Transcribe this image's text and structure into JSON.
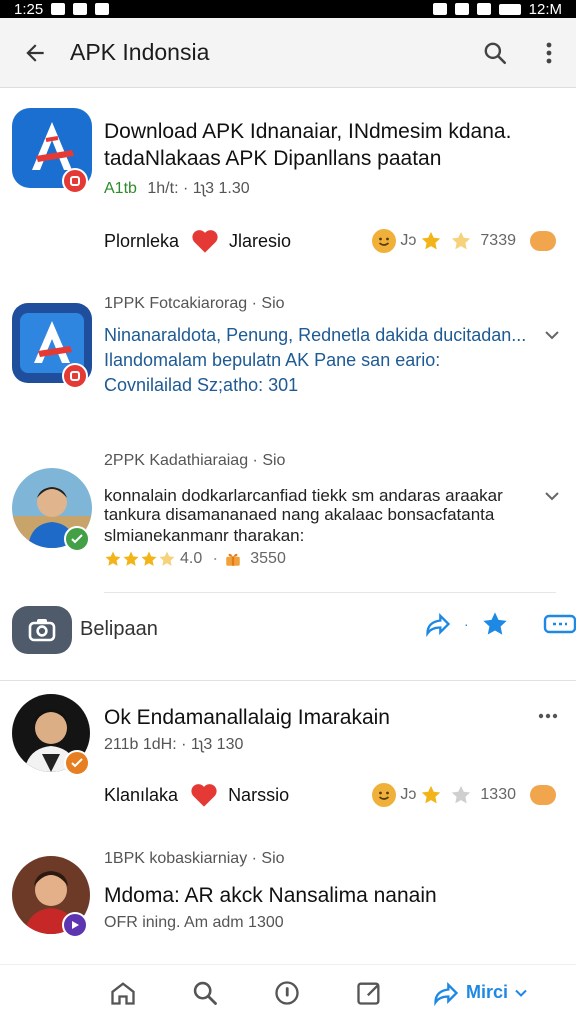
{
  "status_bar": {
    "time": "1:25",
    "right_text": "12:M"
  },
  "appbar": {
    "title": "APK Indonsia"
  },
  "item1": {
    "title_line1": "Download APK Idnanaiar, INdmesim kdana.",
    "title_line2": "tadaNlakaas APK Dipanllans paatan",
    "meta_a": "A1tb",
    "meta_b": "1h/t: · 1ʅ3 1.30",
    "reaction_name": "Plornleka",
    "reaction_label": "Jlaresio",
    "rating_text": "Jɔ",
    "rating_count": "7339"
  },
  "item2": {
    "header": "1PPK Fotcakiarorag · Sio",
    "line1": "Ninanaraldota, Penung, Rednetla dakida ducitadan...",
    "line2": "Ilandomalam bepulatn AK Pane san eario:",
    "line3": "Covnilailad Sz;atho: 301"
  },
  "item3": {
    "header": "2PPK Kadathiaraiag · Sio",
    "line1": "konnalain dodkarlarcanfiad tiekk sm andaras araakar",
    "line2": "tankura disamananaed nang akalaac bonsacfatanta",
    "line3": "slmianekanmanr tharakan:",
    "rating": "4.0",
    "count": "3550"
  },
  "section": {
    "label": "Belipaan"
  },
  "item4": {
    "title": "Ok Endamanallalaig Imarakain",
    "meta": "211b 1dH: · 1ʅ3 130",
    "reaction_name": "Klanılaka",
    "reaction_label": "Narssio",
    "rating_text": "Jɔ",
    "rating_count": "1330"
  },
  "item5": {
    "header": "1BPK kobaskiarniay · Sio",
    "title": "Mdoma: AR akck Nansalima nanain",
    "meta": "OFR ining. Am adm 1300"
  },
  "bottomnav": {
    "label": "Mirci"
  },
  "colors": {
    "accent": "#1e88e5",
    "link_blue": "#1e5a94",
    "star": "#f2b418",
    "heart": "#e53935",
    "green": "#2e8b2e"
  }
}
